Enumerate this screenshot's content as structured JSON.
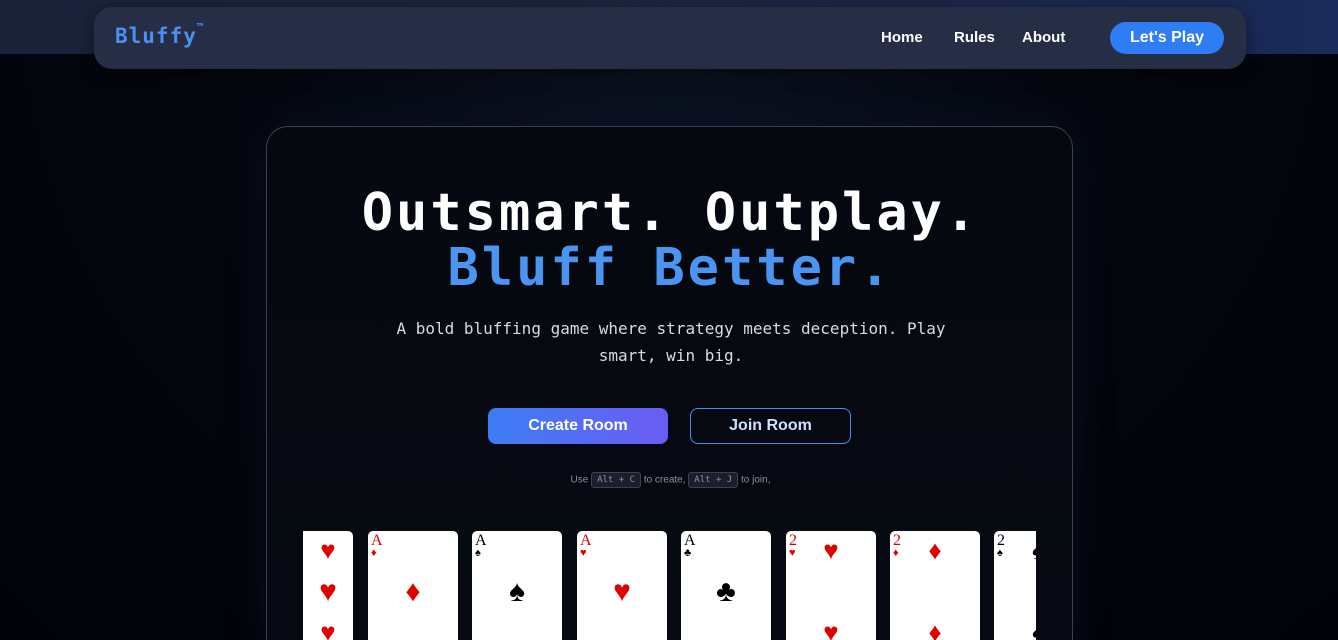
{
  "nav": {
    "logo": "Bluffy",
    "logo_tm": "™",
    "links": [
      "Home",
      "Rules",
      "About"
    ],
    "cta": "Let's Play"
  },
  "hero": {
    "line1": "Outsmart. Outplay.",
    "line2": "Bluff Better.",
    "subtitle": "A bold bluffing game where strategy meets deception. Play smart, win big.",
    "create_label": "Create Room",
    "join_label": "Join Room",
    "hint": {
      "use": "Use",
      "create_keys": "Alt + C",
      "to_create": "to create,",
      "join_keys": "Alt + J",
      "to_join": "to join,"
    }
  },
  "cards": [
    {
      "rank": "",
      "suit": "♥",
      "color": "#e00000"
    },
    {
      "rank": "A",
      "suit": "♦",
      "color": "#e00000"
    },
    {
      "rank": "A",
      "suit": "♠",
      "color": "#000000"
    },
    {
      "rank": "A",
      "suit": "♥",
      "color": "#e00000"
    },
    {
      "rank": "A",
      "suit": "♣",
      "color": "#000000"
    },
    {
      "rank": "2",
      "suit": "♥",
      "color": "#e00000"
    },
    {
      "rank": "2",
      "suit": "♦",
      "color": "#e00000"
    },
    {
      "rank": "2",
      "suit": "♠",
      "color": "#000000"
    }
  ]
}
